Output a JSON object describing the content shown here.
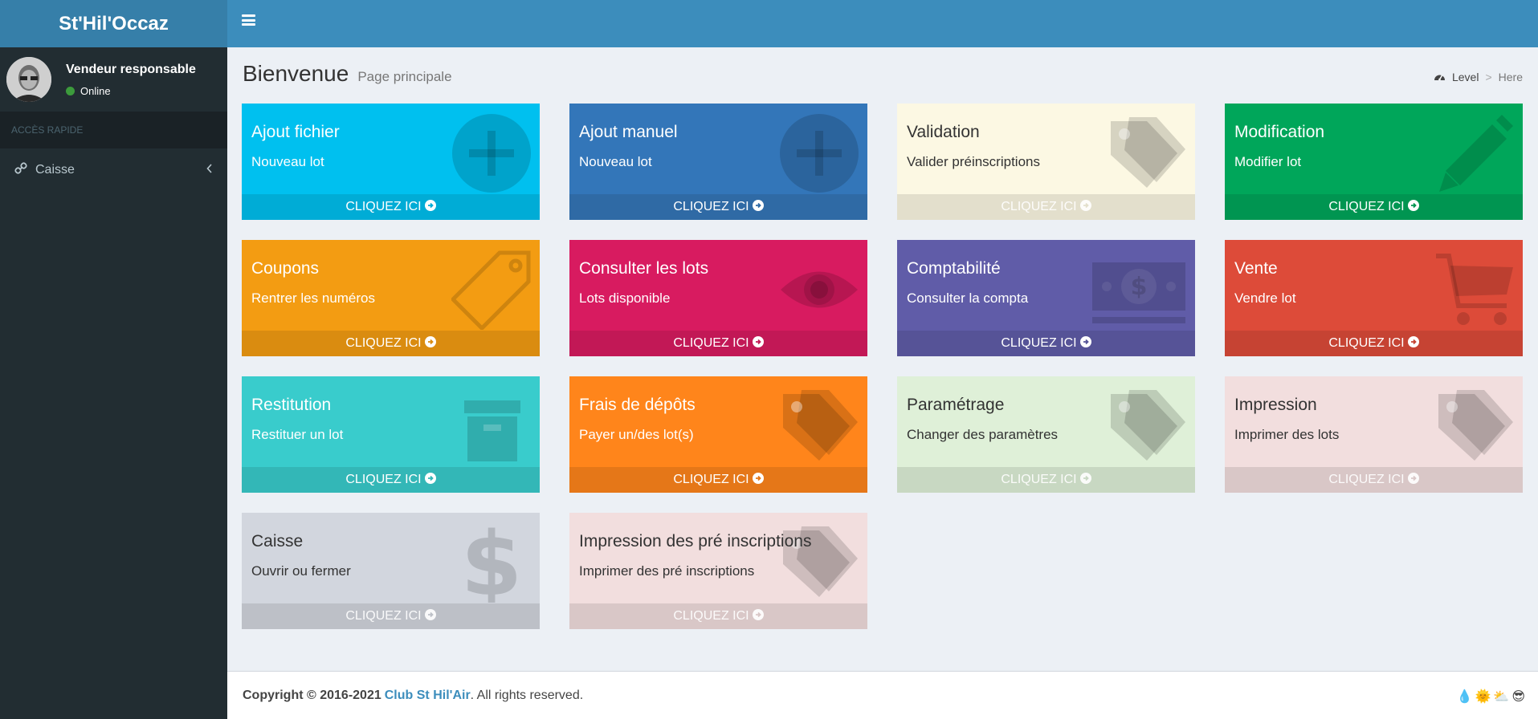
{
  "app": {
    "title": "St'Hil'Occaz"
  },
  "user": {
    "name": "Vendeur responsable",
    "status": "Online"
  },
  "sidebar": {
    "section_header": "ACCÈS RAPIDE",
    "items": [
      {
        "label": "Caisse",
        "icon": "link-icon"
      }
    ]
  },
  "page": {
    "title": "Bienvenue",
    "subtitle": "Page principale"
  },
  "breadcrumb": {
    "level": "Level",
    "here": "Here"
  },
  "tiles": [
    {
      "title": "Ajout fichier",
      "desc": "Nouveau lot",
      "cta": "CLIQUEZ ICI",
      "bg": "#00c0ef",
      "footer": "#00acd6",
      "icon": "plus-circle-icon"
    },
    {
      "title": "Ajout manuel",
      "desc": "Nouveau lot",
      "cta": "CLIQUEZ ICI",
      "bg": "#3376b9",
      "footer": "#2f6aa5",
      "icon": "plus-circle-icon"
    },
    {
      "title": "Validation",
      "desc": "Valider préinscriptions",
      "cta": "CLIQUEZ ICI",
      "bg": "#fcf8e3",
      "footer": "#e3dfcc",
      "icon": "tags-icon"
    },
    {
      "title": "Modification",
      "desc": "Modifier lot",
      "cta": "CLIQUEZ ICI",
      "bg": "#00a65a",
      "footer": "#009551",
      "icon": "pencil-icon"
    },
    {
      "title": "Coupons",
      "desc": "Rentrer les numéros",
      "cta": "CLIQUEZ ICI",
      "bg": "#f39c12",
      "footer": "#da8c10",
      "icon": "tag-icon"
    },
    {
      "title": "Consulter les lots",
      "desc": "Lots disponible",
      "cta": "CLIQUEZ ICI",
      "bg": "#d81b60",
      "footer": "#c21856",
      "icon": "eye-icon"
    },
    {
      "title": "Comptabilité",
      "desc": "Consulter la compta",
      "cta": "CLIQUEZ ICI",
      "bg": "#605ca8",
      "footer": "#565397",
      "icon": "money-icon"
    },
    {
      "title": "Vente",
      "desc": "Vendre lot",
      "cta": "CLIQUEZ ICI",
      "bg": "#dd4b39",
      "footer": "#c64333",
      "icon": "cart-icon"
    },
    {
      "title": "Restitution",
      "desc": "Restituer un lot",
      "cta": "CLIQUEZ ICI",
      "bg": "#39cccc",
      "footer": "#33b7b7",
      "icon": "archive-icon"
    },
    {
      "title": "Frais de dépôts",
      "desc": "Payer un/des lot(s)",
      "cta": "CLIQUEZ ICI",
      "bg": "#ff851b",
      "footer": "#e57718",
      "icon": "tags-icon"
    },
    {
      "title": "Paramétrage",
      "desc": "Changer des paramètres",
      "cta": "CLIQUEZ ICI",
      "bg": "#dff0d8",
      "footer": "#c8d8c2",
      "icon": "tags-icon"
    },
    {
      "title": "Impression",
      "desc": "Imprimer des lots",
      "cta": "CLIQUEZ ICI",
      "bg": "#f2dede",
      "footer": "#d9c7c7",
      "icon": "tags-icon"
    },
    {
      "title": "Caisse",
      "desc": "Ouvrir ou fermer",
      "cta": "CLIQUEZ ICI",
      "bg": "#d2d6de",
      "footer": "#bdc0c7",
      "icon": "dollar-icon"
    },
    {
      "title": "Impression des pré inscriptions",
      "desc": "Imprimer des pré inscriptions",
      "cta": "CLIQUEZ ICI",
      "bg": "#f2dede",
      "footer": "#d9c7c7",
      "icon": "tags-icon"
    }
  ],
  "footer": {
    "copyright": "Copyright © 2016-2021",
    "club": "Club St Hil'Air",
    "rights": ". All rights reserved."
  }
}
